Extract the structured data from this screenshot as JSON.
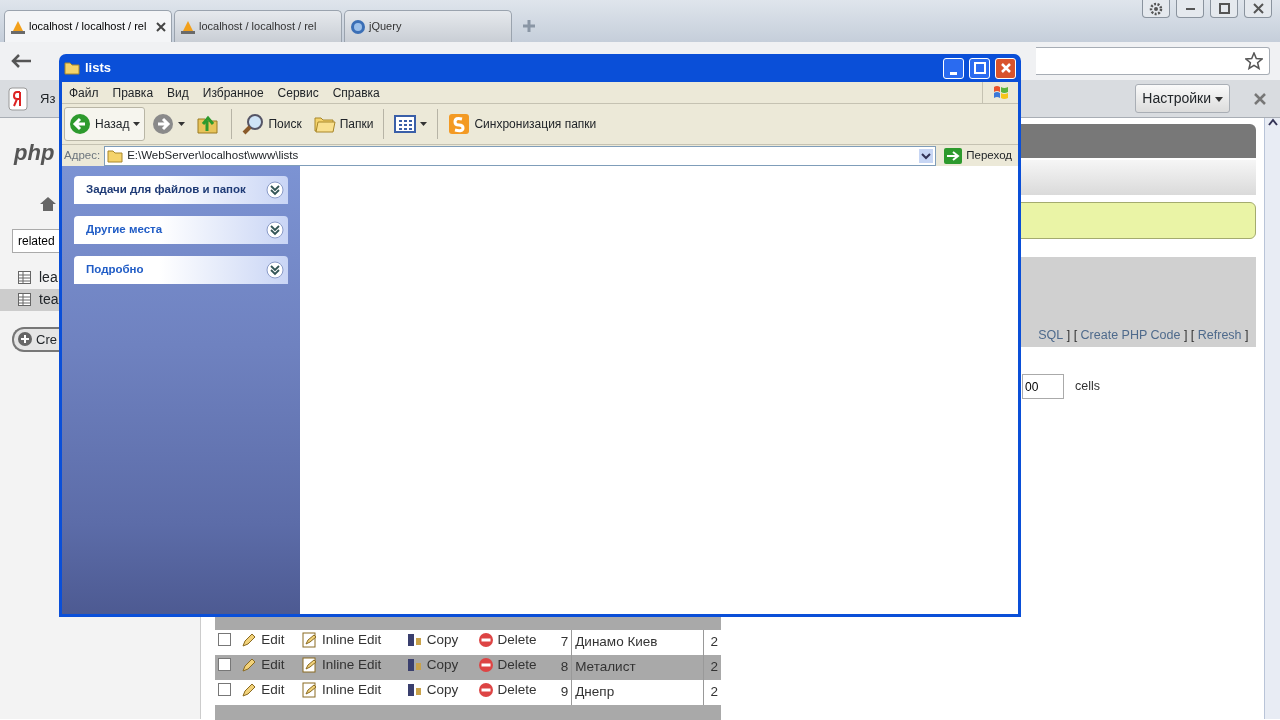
{
  "browser": {
    "tabs": [
      {
        "title": "localhost / localhost / rel",
        "selected": true,
        "closable": true
      },
      {
        "title": "localhost / localhost / rel",
        "selected": false,
        "closable": false
      },
      {
        "title": "jQuery",
        "selected": false,
        "closable": false
      }
    ],
    "bookmark": "Яз",
    "settings_button": "Настройки"
  },
  "pma": {
    "logo": "php",
    "filter": "related",
    "tables": [
      {
        "name": "lea",
        "selected": false
      },
      {
        "name": "tea",
        "selected": true
      }
    ],
    "create_button": "Cre",
    "link_bar": [
      {
        "kind": "link",
        "text": "SQL"
      },
      {
        "kind": "text",
        "text": "] ["
      },
      {
        "kind": "link",
        "text": "Create PHP Code"
      },
      {
        "kind": "text",
        "text": "] ["
      },
      {
        "kind": "link",
        "text": "Refresh"
      },
      {
        "kind": "text",
        "text": "]"
      }
    ],
    "rows_field": "00",
    "rows_unit": "cells",
    "rows": [
      {
        "checked": false,
        "actions": [
          "Edit",
          "Inline Edit",
          "Copy",
          "Delete"
        ],
        "id": "7",
        "name": "Динамо Киев",
        "value": "2"
      },
      {
        "checked": false,
        "actions": [
          "Edit",
          "Inline Edit",
          "Copy",
          "Delete"
        ],
        "id": "8",
        "name": "Металист",
        "value": "2"
      },
      {
        "checked": false,
        "actions": [
          "Edit",
          "Inline Edit",
          "Copy",
          "Delete"
        ],
        "id": "9",
        "name": "Днепр",
        "value": "2"
      }
    ]
  },
  "explorer": {
    "title": "lists",
    "menu": [
      "Файл",
      "Правка",
      "Вид",
      "Избранное",
      "Сервис",
      "Справка"
    ],
    "toolbar": [
      {
        "kind": "back",
        "label": "Назад"
      },
      {
        "kind": "forward"
      },
      {
        "kind": "up"
      },
      {
        "kind": "search",
        "label": "Поиск"
      },
      {
        "kind": "folders",
        "label": "Папки"
      },
      {
        "kind": "views"
      },
      {
        "kind": "sync",
        "label": "Синхронизация папки"
      }
    ],
    "address_label": "Адрес:",
    "address": "E:\\WebServer\\localhost\\www\\lists",
    "go_button": "Переход",
    "tasks": [
      {
        "title": "Задачи для файлов и папок",
        "expanded": false
      },
      {
        "title": "Другие места",
        "expanded": false
      },
      {
        "title": "Подробно",
        "expanded": false
      }
    ]
  }
}
